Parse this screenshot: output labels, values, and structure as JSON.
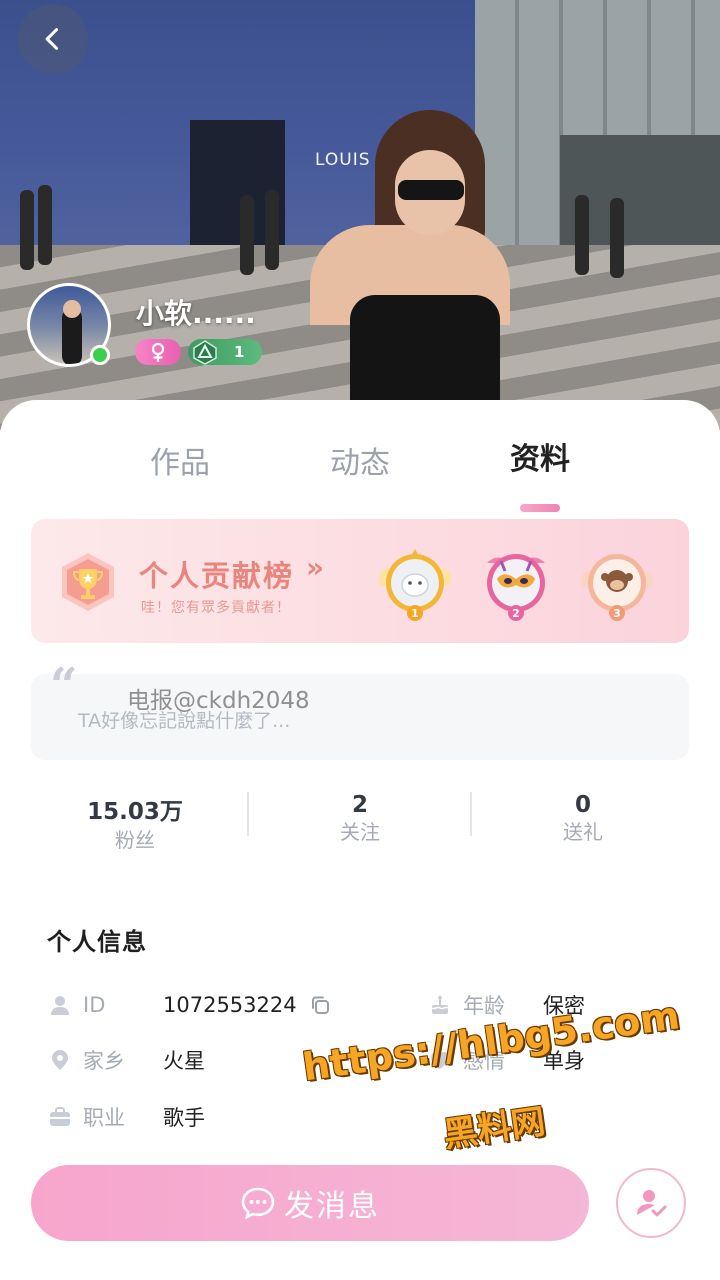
{
  "hero": {
    "sign_text": "LOUIS VUITT"
  },
  "profile": {
    "nickname": "小软......",
    "level": "1",
    "gender_symbol": "♀",
    "online": true
  },
  "tabs": [
    {
      "label": "作品",
      "active": false
    },
    {
      "label": "动态",
      "active": false
    },
    {
      "label": "资料",
      "active": true
    }
  ],
  "contribution": {
    "title": "个人贡献榜",
    "arrow": "»",
    "subtitle": "哇！您有眾多貢獻者！",
    "medals": [
      "1",
      "2",
      "3"
    ]
  },
  "signature": {
    "quote_mark": "“",
    "text": "TA好像忘記說點什麼了..."
  },
  "stats": [
    {
      "value": "15.03万",
      "label": "粉丝"
    },
    {
      "value": "2",
      "label": "关注"
    },
    {
      "value": "0",
      "label": "送礼"
    }
  ],
  "personal_info": {
    "title": "个人信息",
    "id_label": "ID",
    "id_value": "1072553224",
    "hometown_label": "家乡",
    "hometown_value": "火星",
    "job_label": "职业",
    "job_value": "歌手",
    "age_label": "年龄",
    "age_value": "保密",
    "relationship_label": "感情",
    "relationship_value": "单身"
  },
  "actions": {
    "message_label": "发消息"
  },
  "watermarks": {
    "telegram": "电报@ckdh2048",
    "url": "https://hlbg5.com",
    "site_name": "黑料网"
  },
  "colors": {
    "accent_pink": "#f7a5cc",
    "contrib_text": "#e8867e",
    "online_green": "#3ccf4e"
  }
}
